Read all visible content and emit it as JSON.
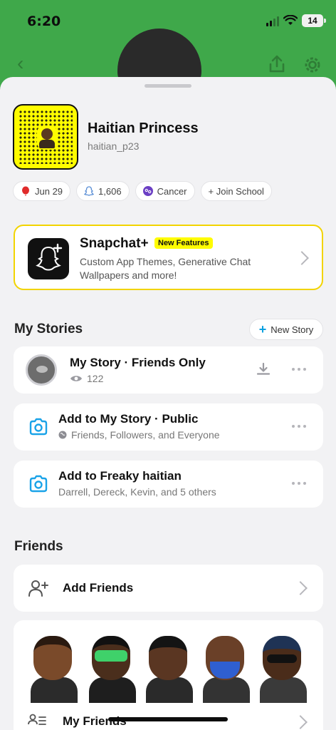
{
  "status_bar": {
    "time": "6:20",
    "battery": "14"
  },
  "profile": {
    "display_name": "Haitian Princess",
    "username": "haitian_p23",
    "chips": [
      {
        "label": "Jun 29",
        "icon": "balloon-icon"
      },
      {
        "label": "1,606",
        "icon": "snapscore-icon"
      },
      {
        "label": "Cancer",
        "icon": "zodiac-icon"
      },
      {
        "label": "+ Join School",
        "icon": ""
      }
    ]
  },
  "snapchat_plus": {
    "title": "Snapchat+",
    "badge": "New Features",
    "description": "Custom App Themes, Generative Chat Wallpapers and more!"
  },
  "my_stories": {
    "title": "My Stories",
    "new_story_label": "New Story",
    "items": [
      {
        "title": "My Story · Friends Only",
        "subtitle": "122"
      },
      {
        "title": "Add to My Story · Public",
        "subtitle": "Friends, Followers, and Everyone"
      },
      {
        "title": "Add to Freaky haitian",
        "subtitle": "Darrell, Dereck, Kevin, and 5 others"
      }
    ]
  },
  "friends": {
    "title": "Friends",
    "add_friends_label": "Add Friends",
    "my_friends_label": "My Friends"
  },
  "colors": {
    "header_green": "#3fa84a",
    "snap_yellow": "#fffc00",
    "accent_blue": "#0aa0e0"
  }
}
